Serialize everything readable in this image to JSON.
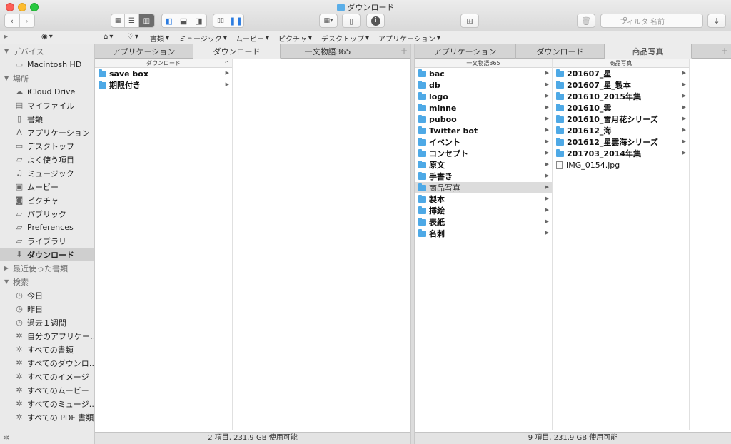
{
  "window": {
    "title": "ダウンロード"
  },
  "toolbar": {
    "back_icon": "chevron-left",
    "forward_icon": "chevron-right",
    "view_icons": [
      "icon-view",
      "list-view",
      "column-view"
    ],
    "layout_icons": [
      "left-panel",
      "bottom-panel",
      "right-panel"
    ],
    "pane_icons": [
      "cover-flow",
      "dual-pane"
    ],
    "search_placeholder": "フィルタ 名前"
  },
  "pathbar": {
    "items": [
      "書類",
      "ミュージック",
      "ムービー",
      "ピクチャ",
      "デスクトップ",
      "アプリケーション"
    ]
  },
  "sidebar": {
    "sections": [
      {
        "title": "デバイス",
        "items": [
          {
            "label": "Macintosh HD",
            "icon": "disk-icon"
          }
        ]
      },
      {
        "title": "場所",
        "items": [
          {
            "label": "iCloud Drive",
            "icon": "cloud-icon"
          },
          {
            "label": "マイファイル",
            "icon": "myfiles-icon"
          },
          {
            "label": "書類",
            "icon": "documents-icon"
          },
          {
            "label": "アプリケーション",
            "icon": "applications-icon"
          },
          {
            "label": "デスクトップ",
            "icon": "desktop-icon"
          },
          {
            "label": "よく使う項目",
            "icon": "folder-icon"
          },
          {
            "label": "ミュージック",
            "icon": "music-icon"
          },
          {
            "label": "ムービー",
            "icon": "movie-icon"
          },
          {
            "label": "ピクチャ",
            "icon": "camera-icon"
          },
          {
            "label": "パブリック",
            "icon": "public-icon"
          },
          {
            "label": "Preferences",
            "icon": "folder-icon"
          },
          {
            "label": "ライブラリ",
            "icon": "folder-icon"
          },
          {
            "label": "ダウンロード",
            "icon": "download-icon"
          }
        ]
      },
      {
        "title": "最近使った書類",
        "items": []
      },
      {
        "title": "検索",
        "items": [
          {
            "label": "今日",
            "icon": "clock-icon"
          },
          {
            "label": "昨日",
            "icon": "clock-icon"
          },
          {
            "label": "過去１週間",
            "icon": "clock-icon"
          },
          {
            "label": "自分のアプリケー…",
            "icon": "gear-icon"
          },
          {
            "label": "すべての書類",
            "icon": "gear-icon"
          },
          {
            "label": "すべてのダウンロ…",
            "icon": "gear-icon"
          },
          {
            "label": "すべてのイメージ",
            "icon": "gear-icon"
          },
          {
            "label": "すべてのムービー",
            "icon": "gear-icon"
          },
          {
            "label": "すべてのミュージ…",
            "icon": "gear-icon"
          },
          {
            "label": "すべての PDF 書類",
            "icon": "gear-icon"
          }
        ]
      }
    ]
  },
  "left_pane": {
    "tabs": [
      "アプリケーション",
      "ダウンロード",
      "一文物語365"
    ],
    "active_tab": 1,
    "column_header": "ダウンロード",
    "items": [
      "save box",
      "期限付き"
    ],
    "status": "2 項目, 231.9 GB 使用可能"
  },
  "right_pane": {
    "tabs": [
      "アプリケーション",
      "ダウンロード",
      "商品写真"
    ],
    "active_tab": 2,
    "col1_header": "一文物語365",
    "col1_items": [
      "bac",
      "db",
      "logo",
      "minne",
      "puboo",
      "Twitter bot",
      "イベント",
      "コンセプト",
      "原文",
      "手書き",
      "商品写真",
      "製本",
      "挿絵",
      "表紙",
      "名刺"
    ],
    "col1_selected": "商品写真",
    "col2_header": "商品写真",
    "col2_folders": [
      "201607_星",
      "201607_星_製本",
      "201610_2015年集",
      "201610_雲",
      "201610_雪月花シリーズ",
      "201612_海",
      "201612_星雲海シリーズ",
      "201703_2014年集"
    ],
    "col2_file": "IMG_0154.jpg",
    "status": "9 項目, 231.9 GB 使用可能"
  },
  "colors": {
    "folder": "#4ea9e6",
    "selection": "#dcdcdc",
    "close": "#fc5f57",
    "minimize": "#fdbc2e",
    "zoom": "#28c840"
  }
}
